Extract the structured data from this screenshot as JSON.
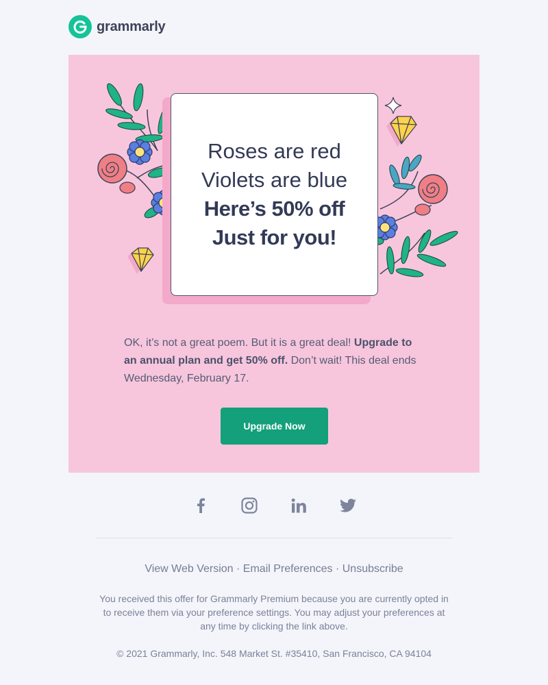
{
  "header": {
    "logo_text": "grammarly",
    "logo_letter": "G"
  },
  "hero": {
    "lines": [
      "Roses are red",
      "Violets are blue",
      "Here’s 50% off",
      "Just for you!"
    ]
  },
  "body": {
    "text_1": "OK, it’s not a great poem. But it is a great deal! ",
    "text_bold": "Upgrade to an annual plan and get 50% off.",
    "text_2": " Don’t wait! This deal ends Wednesday, February 17."
  },
  "cta": {
    "label": "Upgrade Now"
  },
  "social": [
    "facebook-icon",
    "instagram-icon",
    "linkedin-icon",
    "twitter-icon"
  ],
  "footer": {
    "links": [
      "View Web Version",
      "Email Preferences",
      "Unsubscribe"
    ],
    "separator": " · ",
    "notice": "You received this offer for Grammarly Premium because you are currently opted in to receive them via your preference settings. You may adjust your preferences at any time by clicking the link above.",
    "copyright": "© 2021 Grammarly, Inc. 548 Market St. #35410, San Francisco, CA 94104"
  },
  "colors": {
    "page_bg": "#f3f5fa",
    "panel_pink": "#f7c6dc",
    "brand_green": "#15c39a",
    "button_green": "#13a07a",
    "leaf_green": "#1fb386",
    "flower_blue": "#5a7fe0",
    "rose_red": "#ef7f85",
    "gem_yellow": "#ffd24d"
  }
}
